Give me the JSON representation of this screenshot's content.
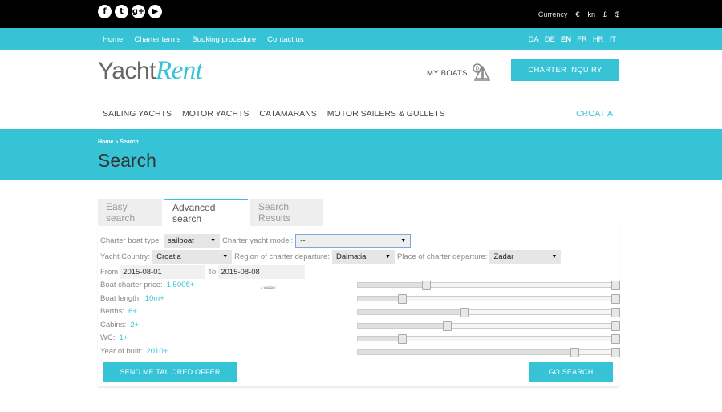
{
  "topbar": {
    "social": [
      {
        "icon": "facebook-icon",
        "glyph": "f"
      },
      {
        "icon": "twitter-icon",
        "glyph": "t"
      },
      {
        "icon": "google-plus-icon",
        "glyph": "g+"
      },
      {
        "icon": "youtube-icon",
        "glyph": "▶"
      }
    ],
    "currency_label": "Currency",
    "currencies": [
      "€",
      "kn",
      "£",
      "$"
    ]
  },
  "nav": {
    "links": [
      "Home",
      "Charter terms",
      "Booking procedure",
      "Contact us"
    ],
    "languages": [
      "DA",
      "DE",
      "EN",
      "FR",
      "HR",
      "IT"
    ],
    "active_language": "EN"
  },
  "header": {
    "logo_part1": "Yacht",
    "logo_part2": "Rent",
    "my_boats_label": "MY BOATS",
    "my_boats_count": "0",
    "inquiry_button": "CHARTER INQUIRY"
  },
  "categories": {
    "items": [
      "SAILING YACHTS",
      "MOTOR YACHTS",
      "CATAMARANS",
      "MOTOR SAILERS & GULLETS"
    ],
    "country": "CROATIA"
  },
  "hero": {
    "breadcrumb_home": "Home",
    "breadcrumb_sep": "»",
    "breadcrumb_current": "Search",
    "title": "Search"
  },
  "tabs": [
    "Easy search",
    "Advanced search",
    "Search Results"
  ],
  "active_tab": "Advanced search",
  "form": {
    "boat_type_label": "Charter boat type:",
    "boat_type_value": "sailboat",
    "model_label": "Charter yacht model:",
    "model_value": "--",
    "country_label": "Yacht Country:",
    "country_value": "Croatia",
    "region_label": "Region of charter departure:",
    "region_value": "Dalmatia",
    "place_label": "Place of charter departure:",
    "place_value": "Zadar",
    "from_label": "From",
    "from_value": "2015-08-01",
    "to_label": "To",
    "to_value": "2015-08-08",
    "price_label": "Boat charter price:",
    "price_value": "1.500€+",
    "price_unit": "/ week",
    "length_label": "Boat length:",
    "length_value": "10m+",
    "berths_label": "Berths:",
    "berths_value": "6+",
    "cabins_label": "Cabins:",
    "cabins_value": "2+",
    "wc_label": "WC:",
    "wc_value": "1+",
    "year_label": "Year of built:",
    "year_value": "2010+"
  },
  "sliders": {
    "price": 0.26,
    "length": 0.17,
    "berths": 0.41,
    "cabins": 0.34,
    "wc": 0.17,
    "year": 0.83
  },
  "buttons": {
    "tailored_offer": "SEND ME TAILORED OFFER",
    "go_search": "GO SEARCH"
  },
  "colors": {
    "accent": "#37c3d6",
    "topbar": "#000000"
  }
}
